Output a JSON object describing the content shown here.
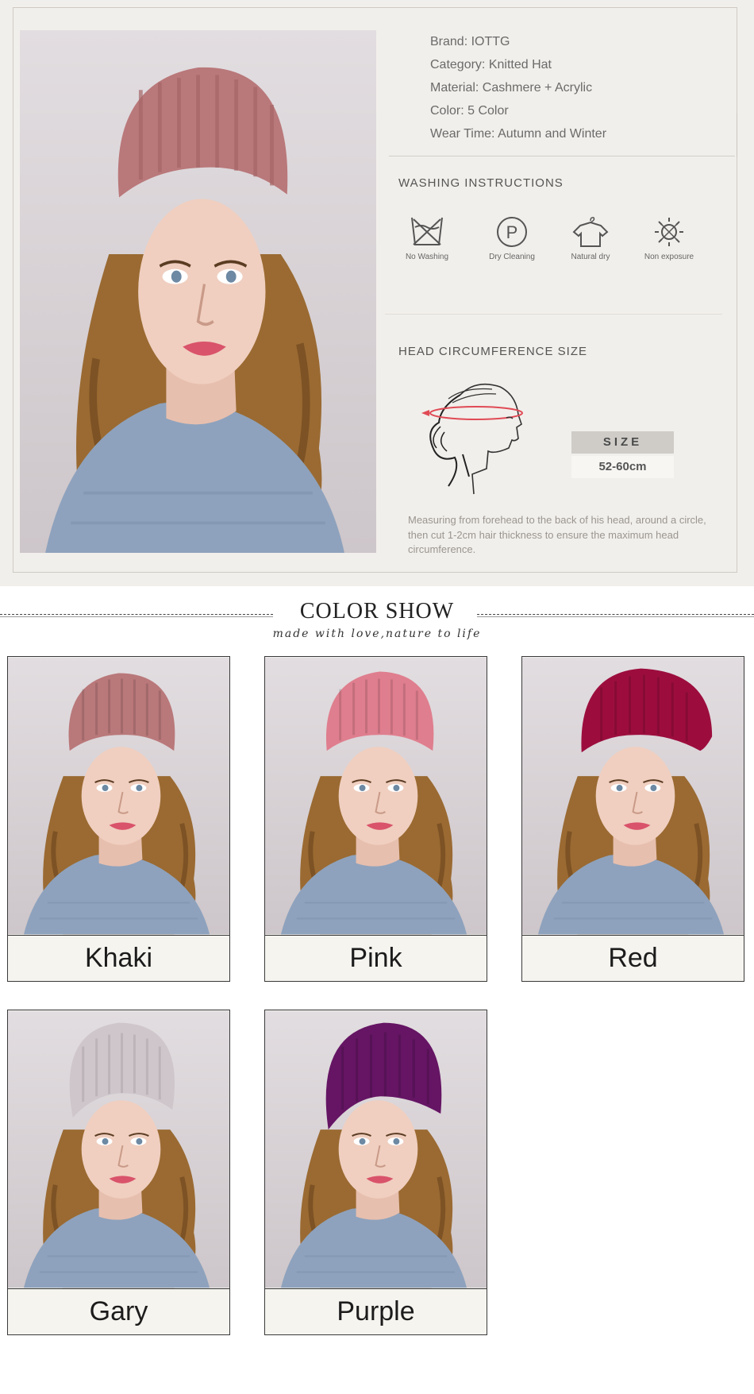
{
  "specs": {
    "brand": "Brand: IOTTG",
    "category": "Category: Knitted Hat",
    "material": "Material: Cashmere + Acrylic",
    "color": "Color: 5 Color",
    "wear_time": "Wear Time: Autumn and Winter"
  },
  "washing": {
    "heading": "WASHING INSTRUCTIONS",
    "items": [
      {
        "label": "No Washing",
        "icon": "no-washing-icon"
      },
      {
        "label": "Dry Cleaning",
        "icon": "dry-cleaning-icon"
      },
      {
        "label": "Natural dry",
        "icon": "natural-dry-icon"
      },
      {
        "label": "Non exposure",
        "icon": "non-exposure-icon"
      }
    ]
  },
  "size": {
    "heading": "HEAD CIRCUMFERENCE SIZE",
    "badge": "SIZE",
    "value": "52-60cm",
    "note": "Measuring from forehead to the back of his head, around a circle, then cut 1-2cm hair thickness to ensure the maximum head circumference."
  },
  "color_show": {
    "title": "COLOR SHOW",
    "subtitle": "made with love,nature to life",
    "colors": [
      {
        "name": "Khaki",
        "hat_color": "#b9787a"
      },
      {
        "name": "Pink",
        "hat_color": "#df7e8e"
      },
      {
        "name": "Red",
        "hat_color": "#9c0d3e"
      },
      {
        "name": "Gary",
        "hat_color": "#cfc6cb"
      },
      {
        "name": "Purple",
        "hat_color": "#651564"
      }
    ]
  },
  "palette": {
    "info_bg": "#f1efeb",
    "photo_bg": "#d8d0d3",
    "sweater": "#8ea2bd",
    "hair": "#9a6a32",
    "skin": "#f0cfc0"
  }
}
